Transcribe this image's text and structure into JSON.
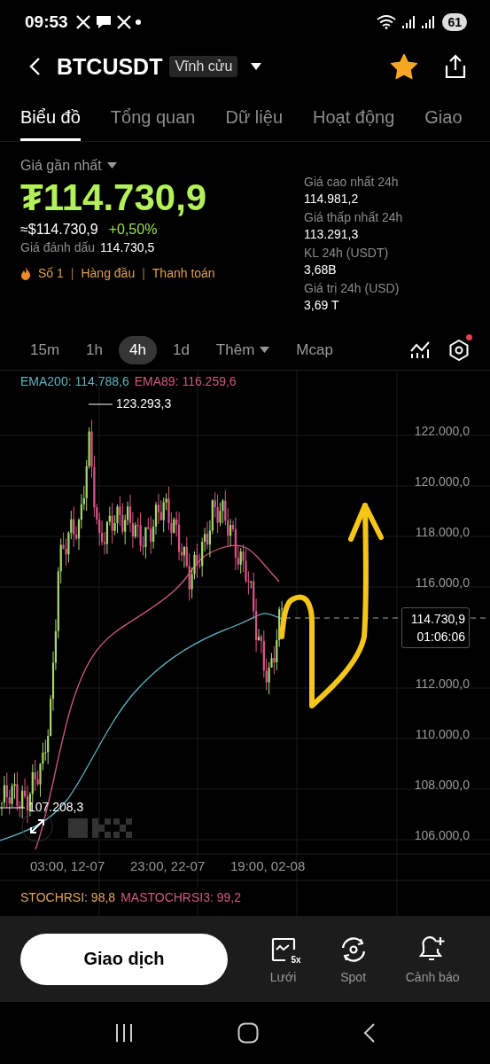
{
  "status_bar": {
    "time": "09:53",
    "battery": "61"
  },
  "header": {
    "symbol": "BTCUSDT",
    "contract_type": "Vĩnh cửu",
    "favorite": true
  },
  "tabs": [
    {
      "label": "Biểu đồ",
      "selected": true
    },
    {
      "label": "Tổng quan",
      "selected": false
    },
    {
      "label": "Dữ liệu",
      "selected": false
    },
    {
      "label": "Hoạt động",
      "selected": false
    },
    {
      "label": "Giao",
      "selected": false
    }
  ],
  "price": {
    "label": "Giá gần nhất",
    "last": "₮114.730,9",
    "usd": "≈$114.730,9",
    "change": "+0,50%",
    "mark_label": "Giá đánh dấu",
    "mark": "114.730,5",
    "tags": [
      "Số 1",
      "Hàng đầu",
      "Thanh toán"
    ],
    "separator": "|"
  },
  "stats": [
    {
      "label": "Giá cao nhất 24h",
      "value": "114.981,2"
    },
    {
      "label": "Giá thấp nhất 24h",
      "value": "113.291,3"
    },
    {
      "label": "KL 24h (USDT)",
      "value": "3,68B"
    },
    {
      "label": "Giá trị 24h (USD)",
      "value": "3,69 T"
    }
  ],
  "intervals": [
    {
      "label": "15m",
      "selected": false,
      "dropdown": false
    },
    {
      "label": "1h",
      "selected": false,
      "dropdown": false
    },
    {
      "label": "4h",
      "selected": true,
      "dropdown": false
    },
    {
      "label": "1d",
      "selected": false,
      "dropdown": false
    },
    {
      "label": "Thêm",
      "selected": false,
      "dropdown": true
    },
    {
      "label": "Mcap",
      "selected": false,
      "dropdown": false
    }
  ],
  "settings_notification": true,
  "chart": {
    "indicators": [
      {
        "text": "EMA200: 114.788,6",
        "color": "#5fb3c2"
      },
      {
        "text": "EMA89: 116.259,6",
        "color": "#cf5a7c"
      }
    ],
    "high_marker": "123.293,3",
    "low_marker": "107.208,3",
    "y_labels": [
      "122.000,0",
      "120.000,0",
      "118.000,0",
      "116.000,0",
      "112.000,0",
      "110.000,0",
      "108.000,0",
      "106.000,0"
    ],
    "current_price": "114.730,9",
    "countdown": "01:06:06",
    "x_labels": [
      "03:00, 12-07",
      "23:00, 22-07",
      "19:00, 02-08"
    ]
  },
  "oscillator": [
    {
      "text": "STOCHRSI: 98,8",
      "color": "#e3a55f"
    },
    {
      "text": "MASTOCHRSI3: 99,2",
      "color": "#cf5a7c"
    }
  ],
  "bottom_bar": {
    "trade_button": "Giao dịch",
    "actions": [
      {
        "kind": "grid",
        "label": "Lưới",
        "badge": "5x"
      },
      {
        "kind": "spot",
        "label": "Spot"
      },
      {
        "kind": "alert",
        "label": "Cảnh báo"
      }
    ]
  }
}
